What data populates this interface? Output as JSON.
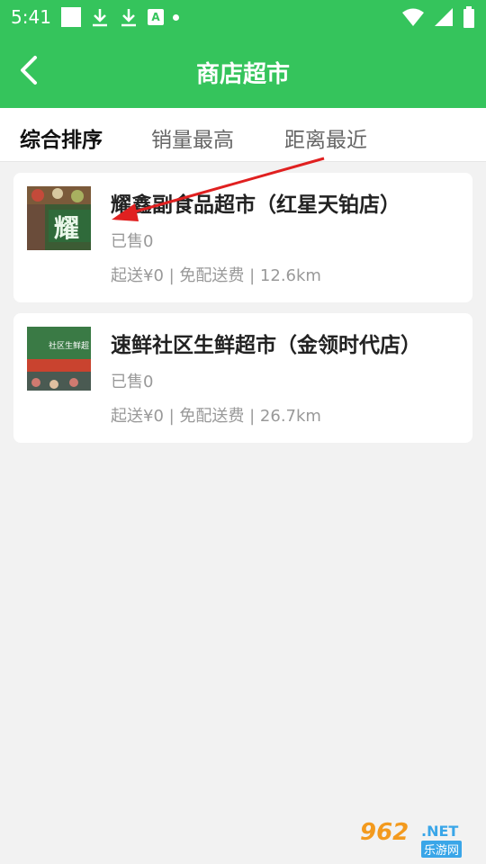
{
  "status_bar": {
    "time": "5:41"
  },
  "app_bar": {
    "title": "商店超市"
  },
  "tabs": [
    {
      "label": "综合排序",
      "active": true
    },
    {
      "label": "销量最高",
      "active": false
    },
    {
      "label": "距离最近",
      "active": false
    }
  ],
  "stores": [
    {
      "name": "耀鑫副食品超市（红星天铂店）",
      "sold": "已售0",
      "meta": "起送¥0 | 免配送费 | 12.6km",
      "thumb_text": "耀"
    },
    {
      "name": "速鲜社区生鲜超市（金领时代店）",
      "sold": "已售0",
      "meta": "起送¥0 | 免配送费 | 26.7km",
      "thumb_text": "社区生鲜超"
    }
  ],
  "watermark": {
    "number": "962",
    "suffix": ".NET",
    "site": "乐游网"
  },
  "colors": {
    "brand_green": "#35c45c",
    "annotation_red": "#e02020"
  }
}
